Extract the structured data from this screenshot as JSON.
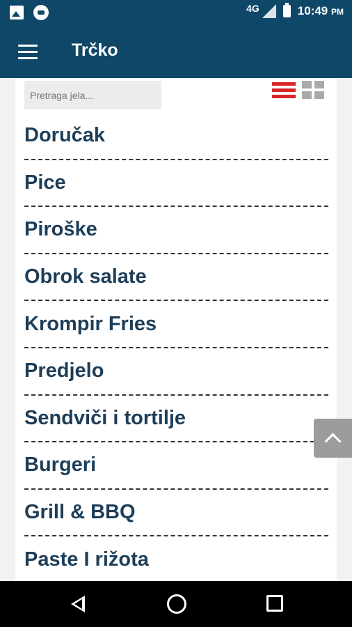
{
  "status_bar": {
    "network": "4G",
    "time": "10:49",
    "ampm": "PM",
    "icons": [
      "image-icon",
      "messenger-icon",
      "signal-icon",
      "battery-icon"
    ]
  },
  "app_bar": {
    "title": "Trčko",
    "menu_icon": "hamburger-menu-icon",
    "color": "#0e4767"
  },
  "search": {
    "placeholder": "Pretraga jela..."
  },
  "view_toggle": {
    "active": "list",
    "active_color": "#d9262a"
  },
  "categories": [
    "Doručak",
    "Pice",
    "Piroške",
    "Obrok salate",
    "Krompir Fries",
    "Predjelo",
    "Sendviči i tortilje",
    "Burgeri",
    "Grill & BBQ",
    "Paste I rižota"
  ],
  "nav_bar": {
    "icons": [
      "back-icon",
      "home-icon",
      "recent-apps-icon"
    ]
  }
}
